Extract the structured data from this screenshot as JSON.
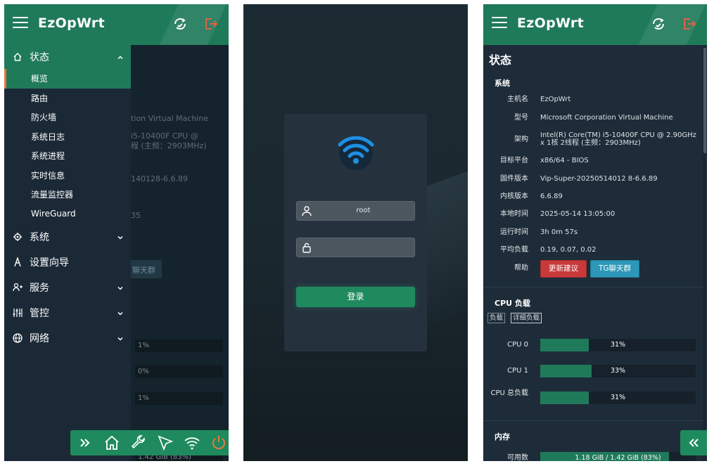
{
  "brand": "EzOpWrt",
  "icons": {
    "menu": "hamburger-menu-icon",
    "refresh": "refresh-icon",
    "logout": "logout-icon",
    "home": "home-icon",
    "gear": "gear-icon",
    "wizard": "wizard-icon",
    "service": "user-add-icon",
    "control": "sliders-icon",
    "network": "globe-icon",
    "chevron": "chevron-icon",
    "expand": "double-chevron-right-icon",
    "collapse": "double-chevron-left-icon",
    "wrench": "wrench-icon",
    "send": "send-icon",
    "wifi": "wifi-icon",
    "power": "power-icon",
    "user": "user-icon",
    "lock": "lock-icon"
  },
  "colors": {
    "accent": "#1f7a5a",
    "active_marker": "#e9773e",
    "danger": "#c9393a",
    "info": "#2c97b8",
    "logout": "#e05236"
  },
  "sidebar": {
    "status": {
      "label": "状态",
      "items": [
        "概览",
        "路由",
        "防火墙",
        "系统日志",
        "系统进程",
        "实时信息",
        "流量监控器",
        "WireGuard"
      ]
    },
    "groups": [
      {
        "label": "系统"
      },
      {
        "label": "设置向导"
      },
      {
        "label": "服务"
      },
      {
        "label": "管控"
      },
      {
        "label": "网络"
      }
    ]
  },
  "behind_sidebar": {
    "texts": [
      "tion Virtual Machine",
      "i5-10400F CPU @",
      "程 (主频：2903MHz)",
      "140128-6.6.89",
      "35",
      "聊天群"
    ],
    "bars": [
      "1%",
      "0%",
      "1%",
      "1.42 GiB (83%)"
    ]
  },
  "login": {
    "username": "root",
    "password": "",
    "button": "登录"
  },
  "status_page": {
    "title": "状态",
    "system": {
      "title": "系统",
      "rows": [
        {
          "label": "主机名",
          "value": "EzOpWrt"
        },
        {
          "label": "型号",
          "value": "Microsoft Corporation Virtual Machine"
        },
        {
          "label": "架构",
          "value": "Intel(R) Core(TM) i5-10400F CPU @ 2.90GHz x 1核 2线程 (主频：2903MHz)"
        },
        {
          "label": "目标平台",
          "value": "x86/64 - BIOS"
        },
        {
          "label": "固件版本",
          "value": "Vip-Super-20250514012 8-6.6.89"
        },
        {
          "label": "内核版本",
          "value": "6.6.89"
        },
        {
          "label": "本地时间",
          "value": "2025-05-14 13:05:00"
        },
        {
          "label": "运行时间",
          "value": "3h 0m 57s"
        },
        {
          "label": "平均负载",
          "value": "0.19, 0.07, 0.02"
        },
        {
          "label": "帮助",
          "value": ""
        }
      ],
      "help_buttons": [
        "更新建议",
        "TG聊天群"
      ]
    },
    "cpu": {
      "title": "CPU 负载",
      "tabs": [
        "负载",
        "详细负载"
      ],
      "bars": [
        {
          "label": "CPU 0",
          "value": 0.31,
          "text": "31%"
        },
        {
          "label": "CPU 1",
          "value": 0.33,
          "text": "33%"
        },
        {
          "label": "CPU 总负载",
          "value": 0.31,
          "text": "31%"
        }
      ]
    },
    "memory": {
      "title": "内存",
      "rows": [
        {
          "label": "可用数",
          "value": 0.83,
          "text": "1.18 GiB / 1.42 GiB (83%)"
        }
      ]
    }
  }
}
